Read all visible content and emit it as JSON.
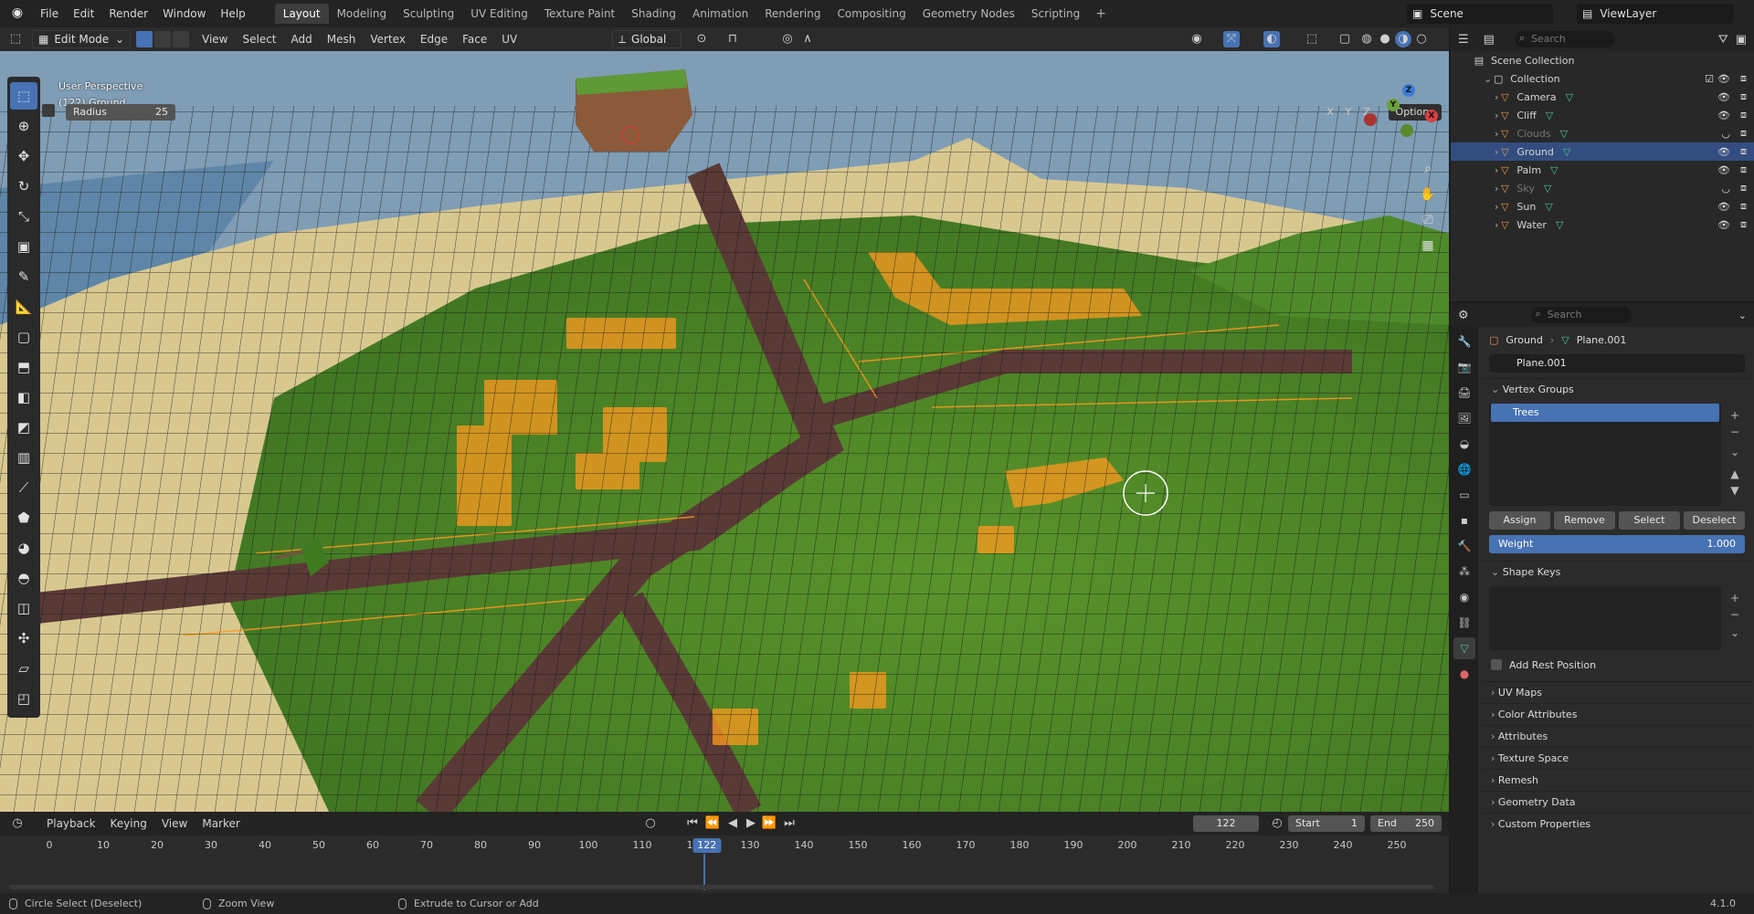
{
  "topbar": {
    "menu": [
      "File",
      "Edit",
      "Render",
      "Window",
      "Help"
    ],
    "workspaces": [
      "Layout",
      "Modeling",
      "Sculpting",
      "UV Editing",
      "Texture Paint",
      "Shading",
      "Animation",
      "Rendering",
      "Compositing",
      "Geometry Nodes",
      "Scripting"
    ],
    "active_workspace": "Layout",
    "add_tab": "+",
    "scene": "Scene",
    "view_layer": "ViewLayer"
  },
  "viewport_header": {
    "mode": "Edit Mode",
    "menus": [
      "View",
      "Select",
      "Add",
      "Mesh",
      "Vertex",
      "Edge",
      "Face",
      "UV"
    ],
    "orientation": "Global"
  },
  "tool_settings": {
    "radius_label": "Radius",
    "radius_value": "25",
    "axes": [
      "X",
      "Y",
      "Z"
    ],
    "options": "Options"
  },
  "viewport": {
    "perspective": "User Perspective",
    "object_info": "(122) Ground",
    "gizmo": {
      "x": "X",
      "y": "Y",
      "z": "Z"
    }
  },
  "timeline": {
    "menus": [
      "Playback",
      "Keying",
      "View",
      "Marker"
    ],
    "current_frame": "122",
    "start_label": "Start",
    "start_value": "1",
    "end_label": "End",
    "end_value": "250",
    "ticks": [
      "0",
      "10",
      "20",
      "30",
      "40",
      "50",
      "60",
      "70",
      "80",
      "90",
      "100",
      "110",
      "120",
      "130",
      "140",
      "150",
      "160",
      "170",
      "180",
      "190",
      "200",
      "210",
      "220",
      "230",
      "240",
      "250"
    ]
  },
  "statusbar": {
    "left": "Circle Select (Deselect)",
    "middle": "Zoom View",
    "right": "Extrude to Cursor or Add",
    "version": "4.1.0"
  },
  "outliner": {
    "search_placeholder": "Search",
    "scene_collection": "Scene Collection",
    "collection": "Collection",
    "items": [
      {
        "name": "Camera",
        "dim": false,
        "selected": false
      },
      {
        "name": "Cliff",
        "dim": false,
        "selected": false
      },
      {
        "name": "Clouds",
        "dim": true,
        "selected": false
      },
      {
        "name": "Ground",
        "dim": false,
        "selected": true
      },
      {
        "name": "Palm",
        "dim": false,
        "selected": false
      },
      {
        "name": "Sky",
        "dim": true,
        "selected": false
      },
      {
        "name": "Sun",
        "dim": false,
        "selected": false
      },
      {
        "name": "Water",
        "dim": false,
        "selected": false
      }
    ]
  },
  "properties": {
    "search_placeholder": "Search",
    "object": "Ground",
    "mesh": "Plane.001",
    "mesh_field": "Plane.001",
    "vertex_groups": "Vertex Groups",
    "vg_item": "Trees",
    "buttons": [
      "Assign",
      "Remove",
      "Select",
      "Deselect"
    ],
    "weight_label": "Weight",
    "weight_value": "1.000",
    "shape_keys": "Shape Keys",
    "add_rest_position": "Add Rest Position",
    "panels": [
      "UV Maps",
      "Color Attributes",
      "Attributes",
      "Texture Space",
      "Remesh",
      "Geometry Data",
      "Custom Properties"
    ]
  },
  "colors": {
    "accent": "#4772b3",
    "ground": "#4f8a2a",
    "path": "#5a3a36",
    "sand": "#d6c48c",
    "highlight": "#ff9a1f"
  }
}
